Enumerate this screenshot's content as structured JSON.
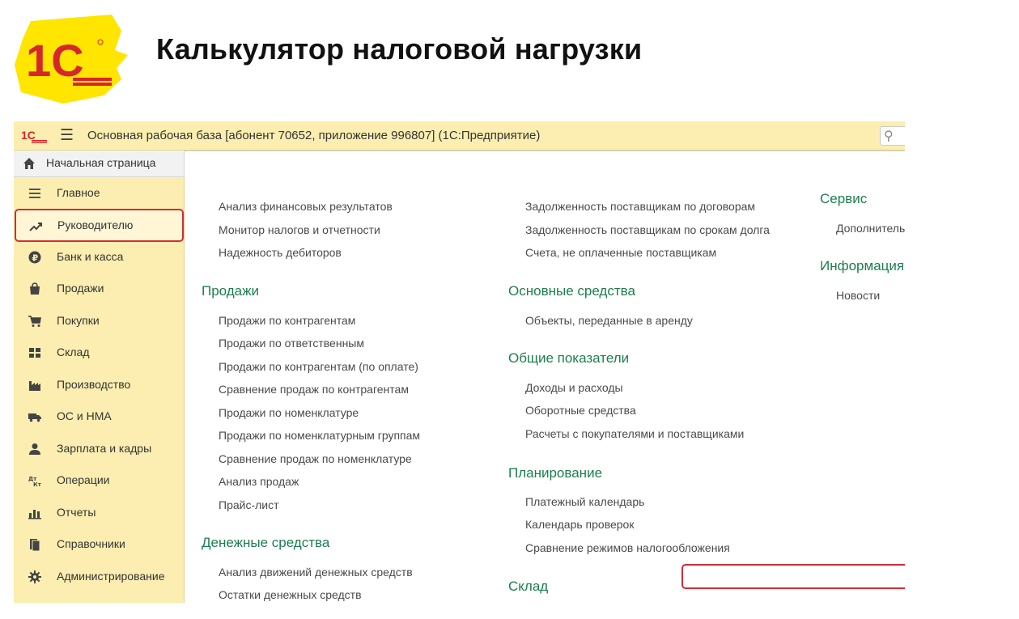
{
  "slide": {
    "title": "Калькулятор налоговой нагрузки"
  },
  "topbar": {
    "logo_text": "1С",
    "menu_icon": "hamburger-icon",
    "app_title": "Основная рабочая база [абонент 70652, приложение 996807]  (1С:Предприятие)",
    "search_icon": "search-icon"
  },
  "home_tab": {
    "label": "Начальная страница",
    "icon": "home-icon"
  },
  "sidebar": {
    "items": [
      {
        "label": "Главное",
        "icon": "list-icon"
      },
      {
        "label": "Руководителю",
        "icon": "trend-icon",
        "active": true
      },
      {
        "label": "Банк и касса",
        "icon": "ruble-icon"
      },
      {
        "label": "Продажи",
        "icon": "bag-icon"
      },
      {
        "label": "Покупки",
        "icon": "cart-icon"
      },
      {
        "label": "Склад",
        "icon": "warehouse-icon"
      },
      {
        "label": "Производство",
        "icon": "factory-icon"
      },
      {
        "label": "ОС и НМА",
        "icon": "truck-icon"
      },
      {
        "label": "Зарплата и кадры",
        "icon": "person-icon"
      },
      {
        "label": "Операции",
        "icon": "operations-icon"
      },
      {
        "label": "Отчеты",
        "icon": "bar-chart-icon"
      },
      {
        "label": "Справочники",
        "icon": "books-icon"
      },
      {
        "label": "Администрирование",
        "icon": "gear-icon"
      }
    ]
  },
  "content": {
    "col1": {
      "top_links": [
        "Анализ финансовых результатов",
        "Монитор налогов и отчетности",
        "Надежность дебиторов"
      ],
      "sales": {
        "title": "Продажи",
        "links": [
          "Продажи по контрагентам",
          "Продажи по ответственным",
          "Продажи по контрагентам (по оплате)",
          "Сравнение продаж по контрагентам",
          "Продажи по номенклатуре",
          "Продажи по номенклатурным группам",
          "Сравнение продаж по номенклатуре",
          "Анализ продаж",
          "Прайс-лист"
        ]
      },
      "cash": {
        "title": "Денежные средства",
        "links": [
          "Анализ движений денежных средств",
          "Остатки денежных средств"
        ]
      }
    },
    "col2": {
      "top_links": [
        "Задолженность поставщикам по договорам",
        "Задолженность поставщикам по срокам долга",
        "Счета, не оплаченные поставщикам"
      ],
      "fixed_assets": {
        "title": "Основные средства",
        "links": [
          "Объекты, переданные в аренду"
        ]
      },
      "general": {
        "title": "Общие показатели",
        "links": [
          "Доходы и расходы",
          "Оборотные средства",
          "Расчеты с покупателями и поставщиками"
        ]
      },
      "planning": {
        "title": "Планирование",
        "links": [
          "Платежный календарь",
          "Календарь проверок",
          "Сравнение режимов налогообложения"
        ]
      },
      "warehouse": {
        "title": "Склад"
      }
    },
    "col3": {
      "service": {
        "title": "Сервис",
        "links": [
          "Дополнитель"
        ]
      },
      "info": {
        "title": "Информация",
        "links": [
          "Новости"
        ]
      }
    }
  },
  "colors": {
    "panel": "#fbeeb0",
    "section": "#1c7e4e",
    "highlight": "#d52b36",
    "logo_red": "#d7262b",
    "logo_yellow": "#ffe500"
  }
}
